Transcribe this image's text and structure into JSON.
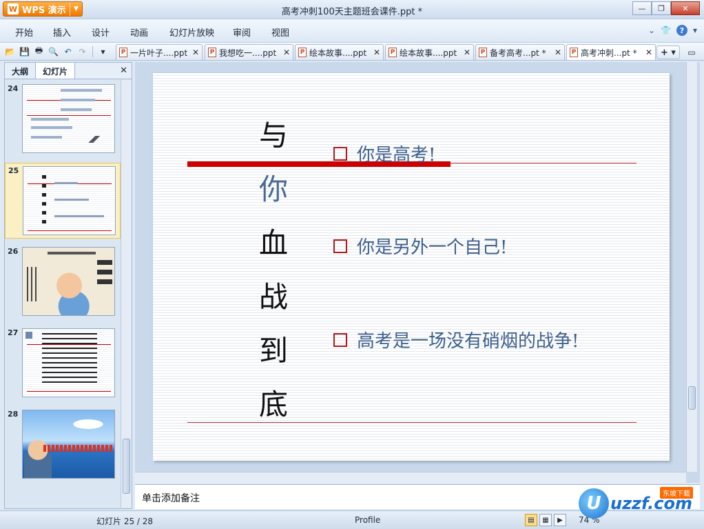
{
  "app": {
    "logo_text": "WPS 演示",
    "window_title": "高考冲刺100天主题班会课件.ppt *"
  },
  "menu": [
    "开始",
    "插入",
    "设计",
    "动画",
    "幻灯片放映",
    "审阅",
    "视图"
  ],
  "tabs": [
    {
      "label": "一片叶子....ppt"
    },
    {
      "label": "我想吃一....ppt"
    },
    {
      "label": "绘本故事....ppt"
    },
    {
      "label": "绘本故事....ppt"
    },
    {
      "label": "备考高考...pt *"
    },
    {
      "label": "高考冲刺...pt *"
    }
  ],
  "left_pane": {
    "tabs": [
      "大纲",
      "幻灯片"
    ],
    "slides": [
      {
        "number": "24"
      },
      {
        "number": "25"
      },
      {
        "number": "26"
      },
      {
        "number": "27"
      },
      {
        "number": "28"
      }
    ],
    "selected_index": 1
  },
  "slide": {
    "vertical_title": [
      "与",
      "你",
      "血",
      "战",
      "到",
      "底"
    ],
    "bullets": [
      "你是高考!",
      "你是另外一个自己!",
      "高考是一场没有硝烟的战争!"
    ]
  },
  "notes_placeholder": "单击添加备注",
  "status": {
    "slide_counter": "幻灯片 25 / 28",
    "profile": "Profile",
    "zoom": "74 %"
  },
  "watermark": {
    "brand": "uzzf.com",
    "badge": "东坡下载"
  },
  "colors": {
    "accent_orange": "#f07800",
    "slide_red": "#cc0000",
    "bullet_blue": "#3c5f8c"
  }
}
